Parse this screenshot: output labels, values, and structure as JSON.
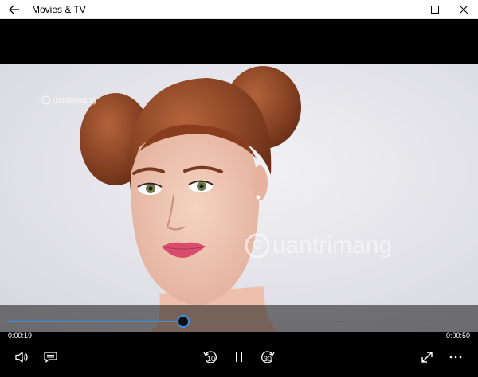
{
  "app": {
    "title": "Movies & TV"
  },
  "video": {
    "watermark_small": "uantrimang",
    "watermark_big": "uantrimang"
  },
  "player": {
    "current_time": "0:00:19",
    "total_time": "0:00:50",
    "progress": 0.38,
    "accent_color": "#3c8fe0"
  },
  "icons": {
    "back": "back-arrow-icon",
    "minimize": "minimize-icon",
    "maximize": "maximize-icon",
    "close": "close-icon",
    "volume": "volume-icon",
    "captions": "captions-icon",
    "skip_back": "skip-back-10-icon",
    "pause": "pause-icon",
    "skip_forward": "skip-forward-30-icon",
    "fullscreen": "fullscreen-icon",
    "more": "more-icon"
  },
  "labels": {
    "skip_back_seconds": "10",
    "skip_forward_seconds": "30"
  }
}
